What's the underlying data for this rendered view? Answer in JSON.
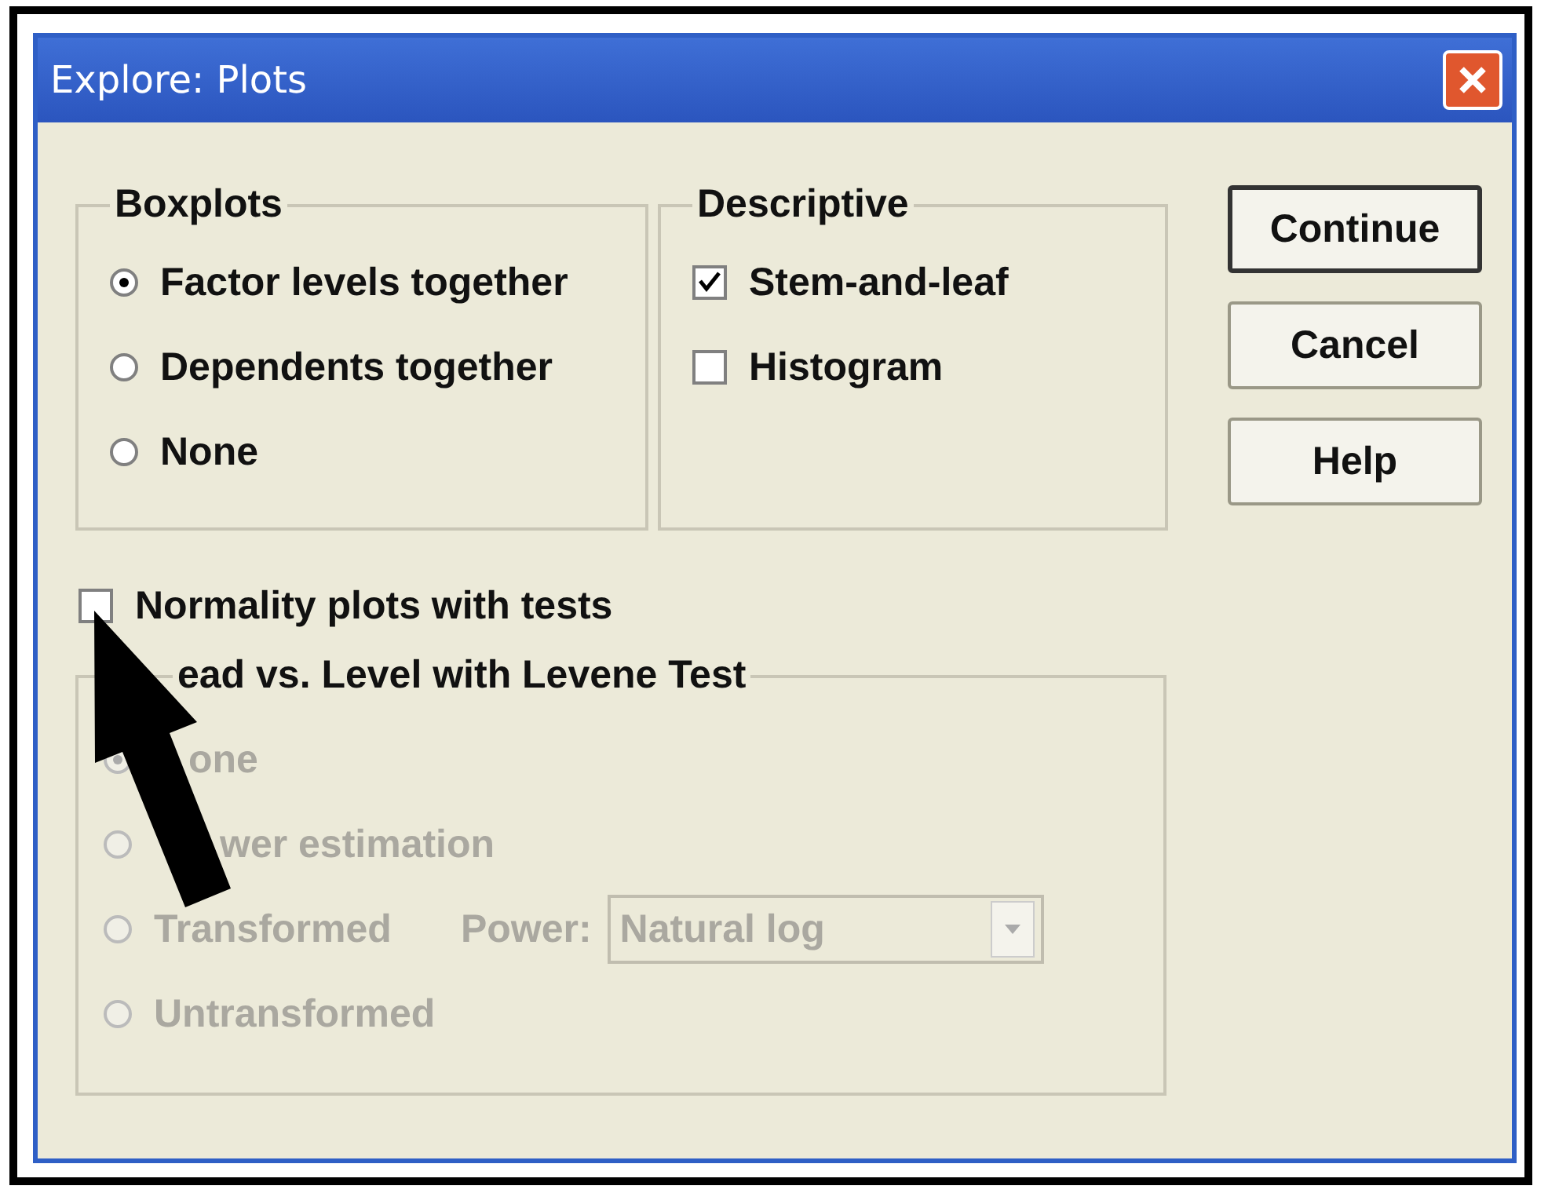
{
  "window": {
    "title": "Explore: Plots"
  },
  "boxplots": {
    "title": "Boxplots",
    "options": [
      {
        "label": "Factor levels together",
        "selected": true
      },
      {
        "label": "Dependents together",
        "selected": false
      },
      {
        "label": "None",
        "selected": false
      }
    ]
  },
  "descriptive": {
    "title": "Descriptive",
    "options": [
      {
        "label": "Stem-and-leaf",
        "checked": true
      },
      {
        "label": "Histogram",
        "checked": false
      }
    ]
  },
  "buttons": [
    "Continue",
    "Cancel",
    "Help"
  ],
  "normality": {
    "label": "Normality plots with tests",
    "checked": false
  },
  "spread": {
    "title": "ead vs. Level with Levene Test",
    "disabled": true,
    "options": [
      {
        "kind": "plain",
        "label": "one",
        "selected": true
      },
      {
        "kind": "plain",
        "label": "wer estimation",
        "selected": false
      },
      {
        "kind": "power",
        "label": "Transformed",
        "selected": false
      },
      {
        "kind": "plain",
        "label": "Untransformed",
        "selected": false
      }
    ],
    "power": {
      "label": "Power:",
      "value": "Natural log"
    }
  }
}
